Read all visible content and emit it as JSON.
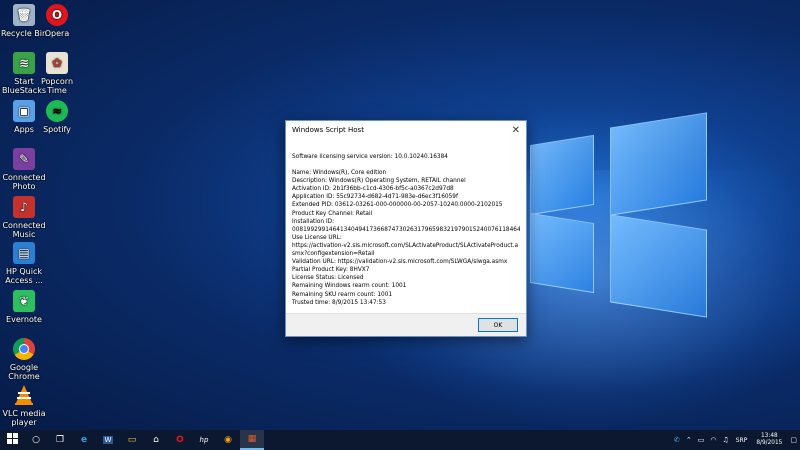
{
  "desktop": {
    "icons": [
      {
        "label": "Recycle Bin",
        "icon": "recycle-bin-icon",
        "color": "#9fb3c8"
      },
      {
        "label": "Opera",
        "icon": "opera-icon",
        "color": "#e0161e"
      },
      {
        "label": "Start BlueStacks",
        "icon": "bluestacks-icon",
        "color": "#3aa34a"
      },
      {
        "label": "Popcorn Time",
        "icon": "popcorn-time-icon",
        "color": "#e9e3d3"
      },
      {
        "label": "Apps",
        "icon": "apps-icon",
        "color": "#5aa0e6"
      },
      {
        "label": "Spotify",
        "icon": "spotify-icon",
        "color": "#1db954"
      },
      {
        "label": "Connected Photo",
        "icon": "connected-photo-icon",
        "color": "#7b3fa0"
      },
      {
        "label": "Connected Music",
        "icon": "connected-music-icon",
        "color": "#c4322e"
      },
      {
        "label": "HP Quick Access ...",
        "icon": "hp-quick-access-icon",
        "color": "#2d7fd3"
      },
      {
        "label": "Evernote",
        "icon": "evernote-icon",
        "color": "#2dbe60"
      },
      {
        "label": "Google Chrome",
        "icon": "chrome-icon",
        "color": "#e8a317"
      },
      {
        "label": "VLC media player",
        "icon": "vlc-icon",
        "color": "#f48b00"
      }
    ]
  },
  "dialog": {
    "title": "Windows Script Host",
    "lines": [
      "Software licensing service version: 10.0.10240.16384",
      "",
      "Name: Windows(R), Core edition",
      "Description: Windows(R) Operating System, RETAIL channel",
      "Activation ID: 2b1f36bb-c1cd-4306-bf5c-a0367c2d97d8",
      "Application ID: 55c92734-d682-4d71-983e-d6ec3f16059f",
      "Extended PID: 03612-03261-000-000000-00-2057-10240.0000-2102015",
      "Product Key Channel: Retail",
      "Installation ID:",
      "008199299146413404941736687473026317965983219790152400761184645",
      "Use License URL:",
      "https://activation-v2.sls.microsoft.com/SLActivateProduct/SLActivateProduct.asmx?configextension=Retail",
      "Validation URL: https://validation-v2.sls.microsoft.com/SLWGA/slwga.asmx",
      "Partial Product Key: 8HVX7",
      "License Status: Licensed",
      "Remaining Windows rearm count: 1001",
      "Remaining SKU rearm count: 1001",
      "Trusted time: 8/9/2015 13:47:53"
    ],
    "ok_label": "OK"
  },
  "taskbar": {
    "start_icon": "windows-start-icon",
    "items": [
      {
        "name": "search",
        "glyph": "○"
      },
      {
        "name": "task-view",
        "glyph": "❐"
      },
      {
        "name": "edge",
        "glyph": "e"
      },
      {
        "name": "word",
        "glyph": "W"
      },
      {
        "name": "file-explorer",
        "glyph": "▭"
      },
      {
        "name": "store",
        "glyph": "🛍"
      },
      {
        "name": "opera",
        "glyph": "O"
      },
      {
        "name": "hp",
        "glyph": "hp"
      },
      {
        "name": "chrome",
        "glyph": "◉"
      },
      {
        "name": "script-host",
        "glyph": "▦"
      }
    ],
    "language": "SRP",
    "time": "13:48",
    "date": "8/9/2015"
  }
}
